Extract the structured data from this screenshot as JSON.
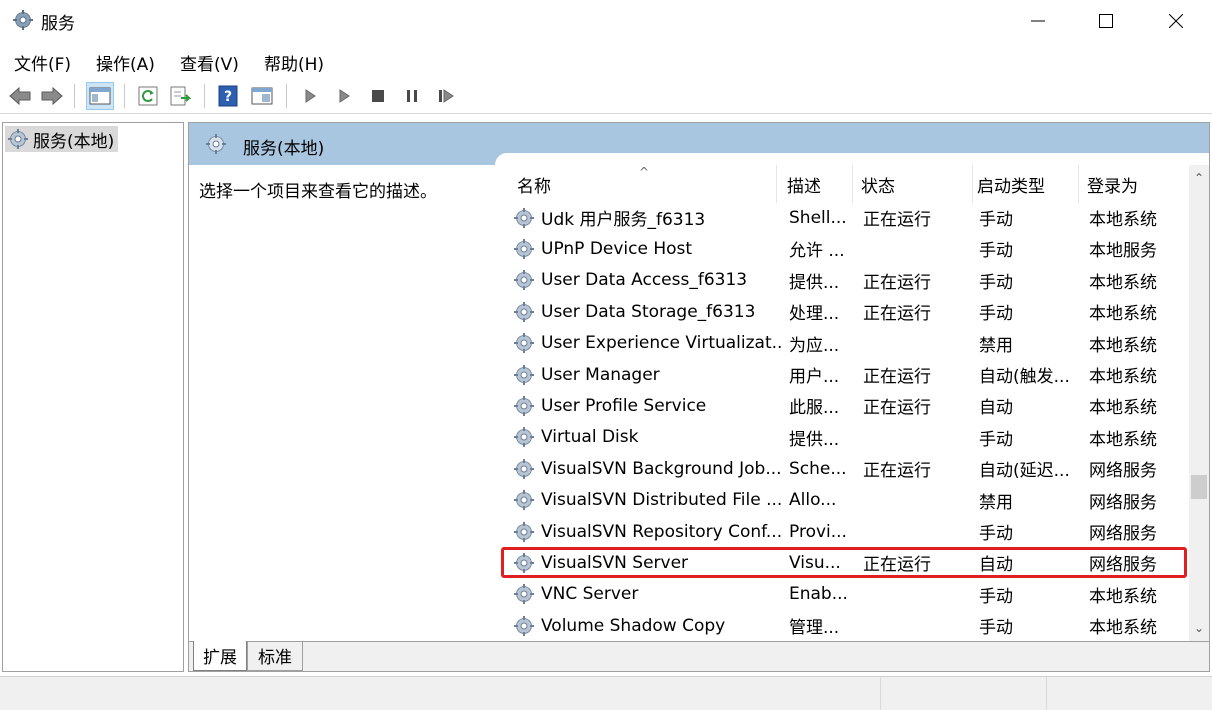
{
  "window": {
    "title": "服务",
    "icon": "gear-icon",
    "controls": {
      "minimize": "minimize-icon",
      "maximize": "maximize-icon",
      "close": "close-icon"
    }
  },
  "menu": [
    {
      "label": "文件(F)"
    },
    {
      "label": "操作(A)"
    },
    {
      "label": "查看(V)"
    },
    {
      "label": "帮助(H)"
    }
  ],
  "toolbar": {
    "buttons": [
      "back-arrow-icon",
      "forward-arrow-icon",
      "show-hide-console-tree-icon",
      "refresh-icon",
      "export-list-icon",
      "help-icon",
      "properties-icon",
      "start-service-icon",
      "start-service-alt-icon",
      "stop-service-icon",
      "pause-service-icon",
      "restart-service-icon"
    ]
  },
  "tree": {
    "root_label": "服务(本地)"
  },
  "main": {
    "header_title": "服务(本地)",
    "description": "选择一个项目来查看它的描述。",
    "columns": {
      "name": "名称",
      "desc": "描述",
      "status": "状态",
      "startup": "启动类型",
      "logon": "登录为"
    },
    "rows": [
      {
        "name": "Udk 用户服务_f6313",
        "desc": "Shell...",
        "status": "正在运行",
        "startup": "手动",
        "logon": "本地系统"
      },
      {
        "name": "UPnP Device Host",
        "desc": "允许 ...",
        "status": "",
        "startup": "手动",
        "logon": "本地服务"
      },
      {
        "name": "User Data Access_f6313",
        "desc": "提供...",
        "status": "正在运行",
        "startup": "手动",
        "logon": "本地系统"
      },
      {
        "name": "User Data Storage_f6313",
        "desc": "处理...",
        "status": "正在运行",
        "startup": "手动",
        "logon": "本地系统"
      },
      {
        "name": "User Experience Virtualizat...",
        "desc": "为应...",
        "status": "",
        "startup": "禁用",
        "logon": "本地系统"
      },
      {
        "name": "User Manager",
        "desc": "用户...",
        "status": "正在运行",
        "startup": "自动(触发...",
        "logon": "本地系统"
      },
      {
        "name": "User Profile Service",
        "desc": "此服...",
        "status": "正在运行",
        "startup": "自动",
        "logon": "本地系统"
      },
      {
        "name": "Virtual Disk",
        "desc": "提供...",
        "status": "",
        "startup": "手动",
        "logon": "本地系统"
      },
      {
        "name": "VisualSVN Background Job...",
        "desc": "Sche...",
        "status": "正在运行",
        "startup": "自动(延迟...",
        "logon": "网络服务"
      },
      {
        "name": "VisualSVN Distributed File ...",
        "desc": "Allo...",
        "status": "",
        "startup": "禁用",
        "logon": "网络服务"
      },
      {
        "name": "VisualSVN Repository Conf...",
        "desc": "Provi...",
        "status": "",
        "startup": "手动",
        "logon": "网络服务"
      },
      {
        "name": "VisualSVN Server",
        "desc": "Visu...",
        "status": "正在运行",
        "startup": "自动",
        "logon": "网络服务",
        "highlighted": true
      },
      {
        "name": "VNC Server",
        "desc": "Enab...",
        "status": "",
        "startup": "手动",
        "logon": "本地系统"
      },
      {
        "name": "Volume Shadow Copy",
        "desc": "管理...",
        "status": "",
        "startup": "手动",
        "logon": "本地系统"
      }
    ],
    "tabs": [
      {
        "label": "扩展"
      },
      {
        "label": "标准"
      }
    ]
  },
  "colors": {
    "header_band": "#a9c6e1",
    "highlight_outline": "#e02020",
    "tree_selected": "#d9d9d9"
  }
}
